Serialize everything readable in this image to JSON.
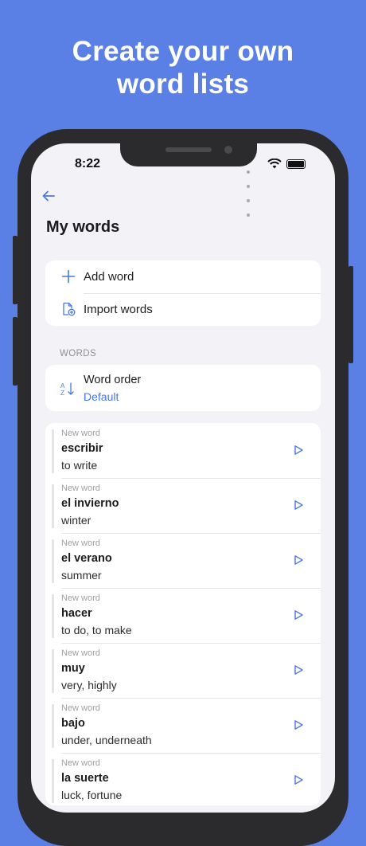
{
  "headline": {
    "line1": "Create your own",
    "line2": "word lists"
  },
  "status": {
    "time": "8:22"
  },
  "header": {
    "title": "My words"
  },
  "actions": [
    {
      "label": "Add word",
      "icon": "plus-icon"
    },
    {
      "label": "Import words",
      "icon": "import-file-icon"
    }
  ],
  "section": {
    "label": "WORDS"
  },
  "order": {
    "title": "Word order",
    "value": "Default",
    "icon": "sort-az-icon"
  },
  "words": [
    {
      "tag": "New word",
      "term": "escribir",
      "translation": "to write"
    },
    {
      "tag": "New word",
      "term": "el invierno",
      "translation": "winter"
    },
    {
      "tag": "New word",
      "term": "el verano",
      "translation": "summer"
    },
    {
      "tag": "New word",
      "term": "hacer",
      "translation": "to do, to make"
    },
    {
      "tag": "New word",
      "term": "muy",
      "translation": "very, highly"
    },
    {
      "tag": "New word",
      "term": "bajo",
      "translation": "under, underneath"
    },
    {
      "tag": "New word",
      "term": "la suerte",
      "translation": "luck, fortune"
    }
  ],
  "colors": {
    "background": "#5a80e6",
    "accent": "#4a78e0",
    "screen": "#f2f2f7"
  }
}
